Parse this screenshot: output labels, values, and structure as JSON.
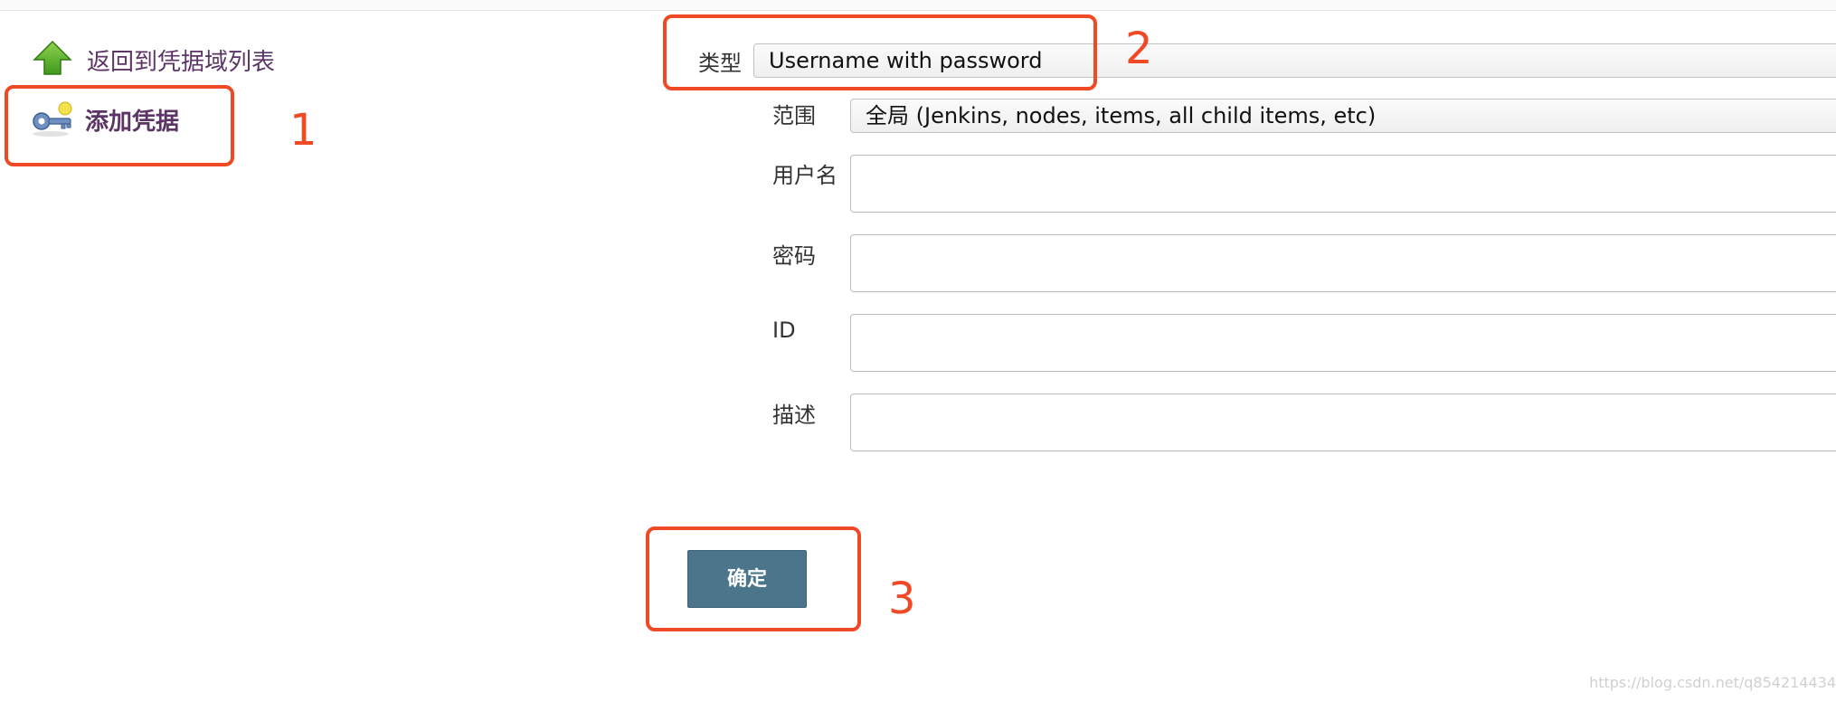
{
  "sidebar": {
    "back_label": "返回到凭据域列表",
    "add_label": "添加凭据",
    "back_icon": "arrow-up-icon",
    "add_icon": "key-icon"
  },
  "form": {
    "type_label": "类型",
    "type_value": "Username with password",
    "scope_label": "范围",
    "scope_value": "全局 (Jenkins, nodes, items, all child items, etc)",
    "username_label": "用户名",
    "username_value": "",
    "password_label": "密码",
    "password_value": "",
    "id_label": "ID",
    "id_value": "",
    "description_label": "描述",
    "description_value": "",
    "ok_label": "确定"
  },
  "annotations": [
    "1",
    "2",
    "3"
  ],
  "watermark": "https://blog.csdn.net/q854214434",
  "colors": {
    "annotation": "#ef4a25",
    "button": "#4b758b",
    "link": "#5c3566"
  }
}
